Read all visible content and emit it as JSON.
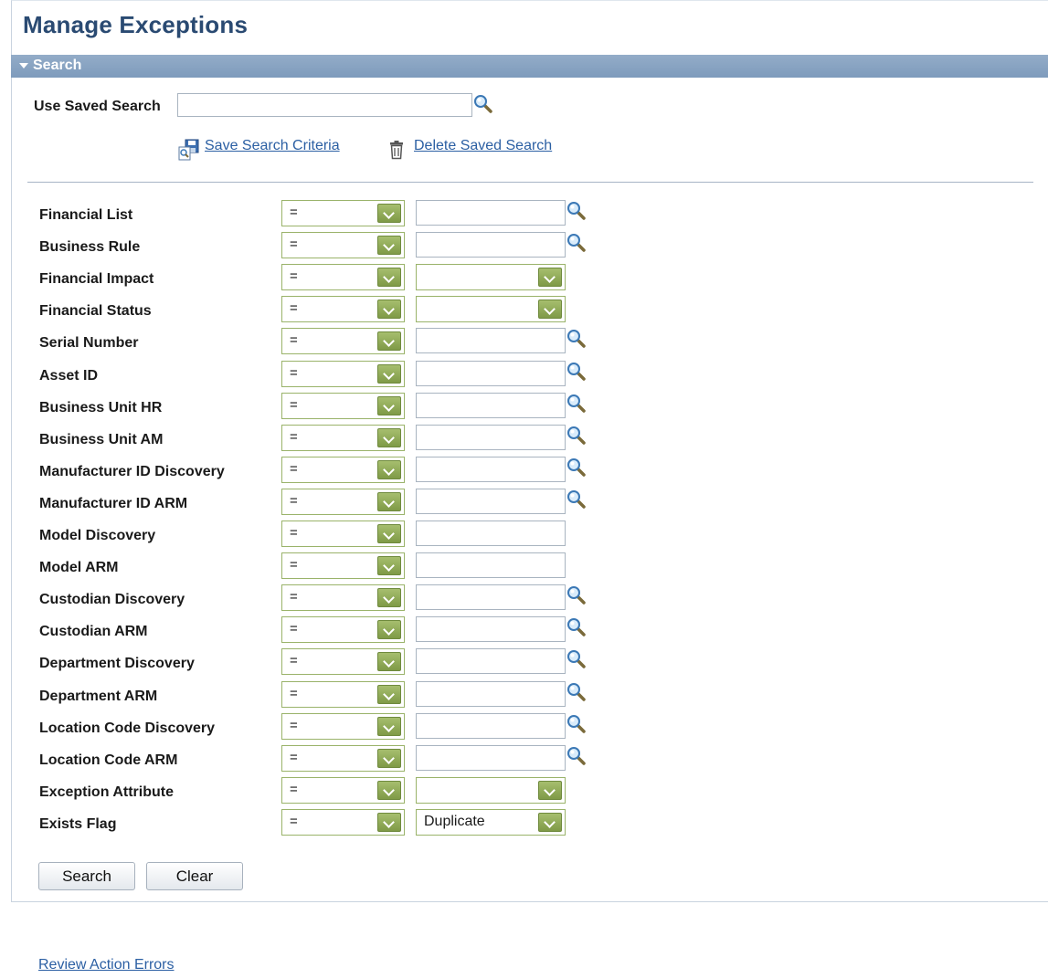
{
  "page": {
    "title": "Manage Exceptions"
  },
  "search_section": {
    "label": "Search"
  },
  "saved_search": {
    "label": "Use Saved Search",
    "value": "",
    "save_link": "Save Search Criteria",
    "delete_link": "Delete Saved Search"
  },
  "criteria": [
    {
      "label": "Financial List",
      "operator": "=",
      "value_type": "lookup",
      "value": ""
    },
    {
      "label": "Business Rule",
      "operator": "=",
      "value_type": "lookup",
      "value": ""
    },
    {
      "label": "Financial Impact",
      "operator": "=",
      "value_type": "select",
      "value": ""
    },
    {
      "label": "Financial Status",
      "operator": "=",
      "value_type": "select",
      "value": ""
    },
    {
      "label": "Serial Number",
      "operator": "=",
      "value_type": "lookup",
      "value": ""
    },
    {
      "label": "Asset ID",
      "operator": "=",
      "value_type": "lookup",
      "value": ""
    },
    {
      "label": "Business Unit HR",
      "operator": "=",
      "value_type": "lookup",
      "value": ""
    },
    {
      "label": "Business Unit AM",
      "operator": "=",
      "value_type": "lookup",
      "value": ""
    },
    {
      "label": "Manufacturer ID Discovery",
      "operator": "=",
      "value_type": "lookup",
      "value": ""
    },
    {
      "label": "Manufacturer ID ARM",
      "operator": "=",
      "value_type": "lookup",
      "value": ""
    },
    {
      "label": "Model Discovery",
      "operator": "=",
      "value_type": "text",
      "value": ""
    },
    {
      "label": "Model ARM",
      "operator": "=",
      "value_type": "text",
      "value": ""
    },
    {
      "label": "Custodian Discovery",
      "operator": "=",
      "value_type": "lookup",
      "value": ""
    },
    {
      "label": "Custodian ARM",
      "operator": "=",
      "value_type": "lookup",
      "value": ""
    },
    {
      "label": "Department Discovery",
      "operator": "=",
      "value_type": "lookup",
      "value": ""
    },
    {
      "label": "Department ARM",
      "operator": "=",
      "value_type": "lookup",
      "value": ""
    },
    {
      "label": "Location Code Discovery",
      "operator": "=",
      "value_type": "lookup",
      "value": ""
    },
    {
      "label": "Location Code ARM",
      "operator": "=",
      "value_type": "lookup",
      "value": ""
    },
    {
      "label": "Exception Attribute",
      "operator": "=",
      "value_type": "select",
      "value": ""
    },
    {
      "label": "Exists Flag",
      "operator": "=",
      "value_type": "select",
      "value": "Duplicate"
    }
  ],
  "buttons": {
    "search": "Search",
    "clear": "Clear"
  },
  "footer": {
    "review_link": "Review Action Errors"
  },
  "colors": {
    "title": "#2a4a72",
    "bar": "#7e9bbc",
    "link": "#2b5fa3",
    "dropdown": "#8aa551"
  },
  "icons": {
    "lookup": "magnifier-icon",
    "save": "save-search-icon",
    "delete": "trash-icon",
    "collapse": "triangle-down-icon"
  }
}
